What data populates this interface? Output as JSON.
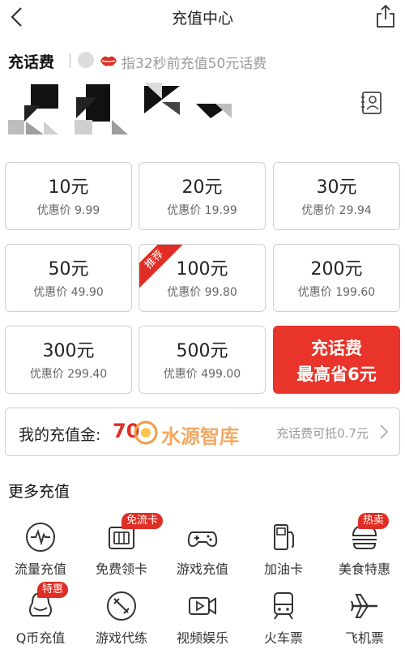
{
  "nav": {
    "title": "充值中心"
  },
  "section": {
    "title": "充话费",
    "notice_lead": "指",
    "notice": "32秒前充值50元话费"
  },
  "cards": [
    {
      "amount": "10元",
      "price": "优惠价 9.99"
    },
    {
      "amount": "20元",
      "price": "优惠价 19.99"
    },
    {
      "amount": "30元",
      "price": "优惠价 29.94"
    },
    {
      "amount": "50元",
      "price": "优惠价 49.90"
    },
    {
      "amount": "100元",
      "price": "优惠价 99.80",
      "badge": "推荐"
    },
    {
      "amount": "200元",
      "price": "优惠价 199.60"
    },
    {
      "amount": "300元",
      "price": "优惠价 299.40"
    },
    {
      "amount": "500元",
      "price": "优惠价 499.00"
    }
  ],
  "promo": {
    "line1": "充话费",
    "line2": "最高省6元"
  },
  "gold": {
    "label": "我的充值金:",
    "value": "70",
    "watermark": "水源智库",
    "hint": "充话费可抵0.7元"
  },
  "more": {
    "title": "更多充值",
    "items": [
      {
        "label": "流量充值",
        "icon": "pulse-icon"
      },
      {
        "label": "免费领卡",
        "icon": "sim-card-icon",
        "badge": "免流卡"
      },
      {
        "label": "游戏充值",
        "icon": "gamepad-icon"
      },
      {
        "label": "加油卡",
        "icon": "fuel-pump-icon"
      },
      {
        "label": "美食特惠",
        "icon": "burger-icon",
        "badge": "热卖"
      },
      {
        "label": "Q币充值",
        "icon": "penguin-icon",
        "badge": "特惠"
      },
      {
        "label": "游戏代练",
        "icon": "sword-icon"
      },
      {
        "label": "视频娱乐",
        "icon": "video-icon"
      },
      {
        "label": "火车票",
        "icon": "train-icon"
      },
      {
        "label": "飞机票",
        "icon": "airplane-icon"
      }
    ]
  },
  "colors": {
    "accent": "#e02e24",
    "promo_bg": "#e8342a",
    "watermark": "#f29b46",
    "border": "#cfcfcf"
  }
}
